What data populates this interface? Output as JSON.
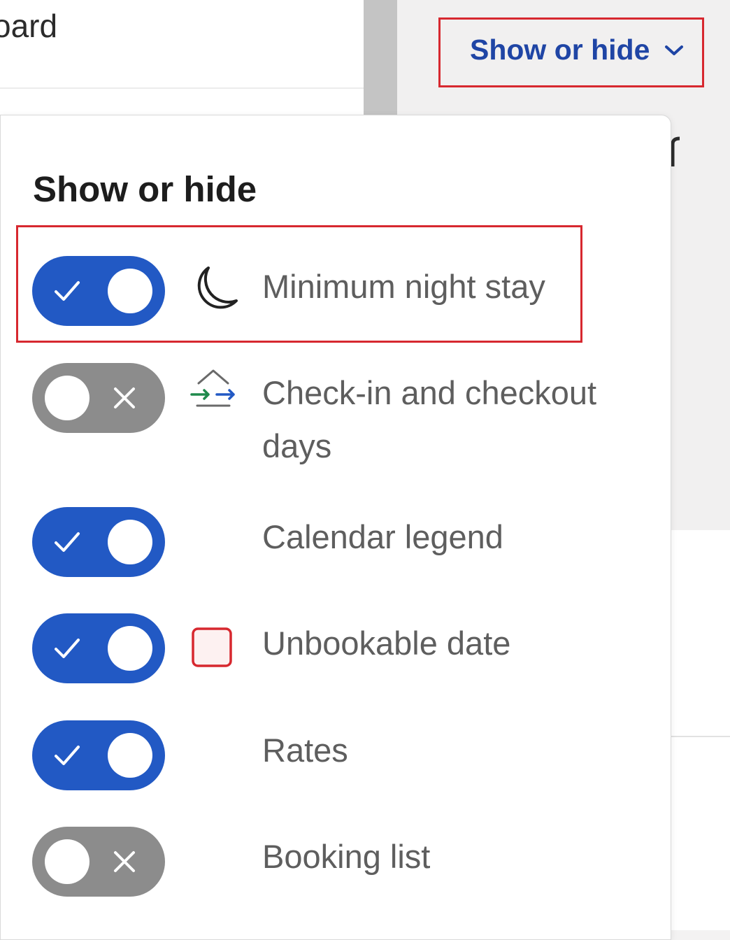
{
  "background": {
    "partial_title": "oard"
  },
  "trigger": {
    "label": "Show or hide",
    "icon": "chevron-down-icon"
  },
  "panel": {
    "title": "Show or hide",
    "items": [
      {
        "label": "Minimum night stay",
        "enabled": true,
        "icon": "moon-icon"
      },
      {
        "label": "Check-in and checkout days",
        "enabled": false,
        "icon": "check-in-checkout-icon"
      },
      {
        "label": "Calendar legend",
        "enabled": true,
        "icon": ""
      },
      {
        "label": "Unbookable date",
        "enabled": true,
        "icon": "unbookable-date-swatch-icon"
      },
      {
        "label": "Rates",
        "enabled": true,
        "icon": ""
      },
      {
        "label": "Booking list",
        "enabled": false,
        "icon": ""
      }
    ]
  },
  "colors": {
    "accent": "#2259c4",
    "toggle_off": "#8c8c8c",
    "link": "#1f45a5",
    "highlight": "#d7282f",
    "unbookable_swatch_border": "#d7282f",
    "unbookable_swatch_fill": "#fdf1f1"
  }
}
